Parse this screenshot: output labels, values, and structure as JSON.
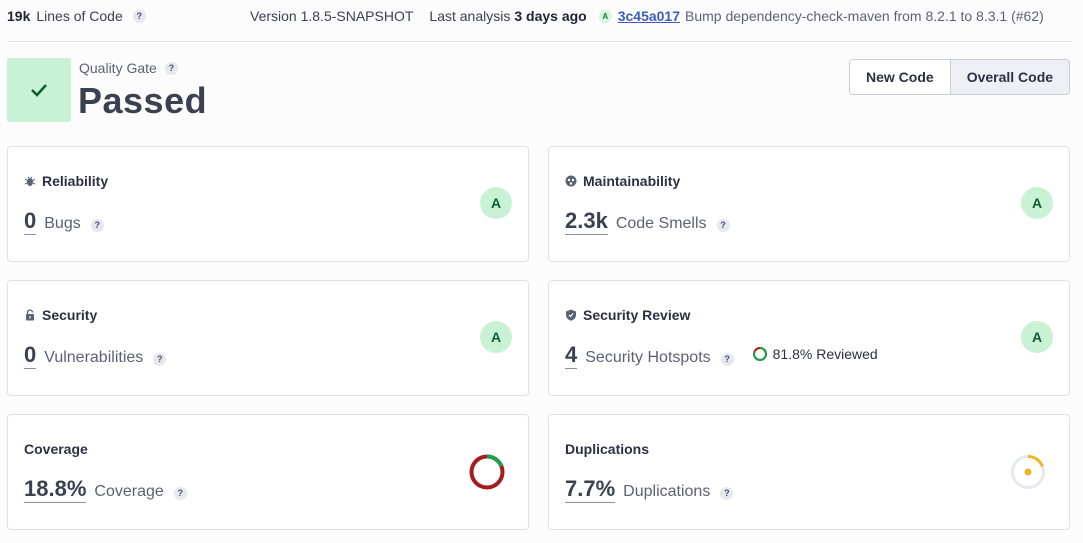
{
  "topbar": {
    "loc_value": "19k",
    "loc_label": "Lines of Code",
    "version": "Version 1.8.5-SNAPSHOT",
    "last_analysis_label": "Last analysis",
    "last_analysis_value": "3 days ago",
    "commit_grade": "A",
    "commit_hash": "3c45a017",
    "commit_message": "Bump dependency-check-maven from 8.2.1 to 8.3.1 (#62)"
  },
  "quality_gate": {
    "label": "Quality Gate",
    "status": "Passed",
    "color": "#c9f2d5"
  },
  "toggle": {
    "new_code": "New Code",
    "overall_code": "Overall Code",
    "selected": "Overall Code"
  },
  "cards": {
    "reliability": {
      "title": "Reliability",
      "value": "0",
      "label": "Bugs",
      "grade": "A",
      "icon": "bug-icon"
    },
    "maintainability": {
      "title": "Maintainability",
      "value": "2.3k",
      "label": "Code Smells",
      "grade": "A",
      "icon": "smell-icon"
    },
    "security": {
      "title": "Security",
      "value": "0",
      "label": "Vulnerabilities",
      "grade": "A",
      "icon": "lock-icon"
    },
    "security_review": {
      "title": "Security Review",
      "value": "4",
      "label": "Security Hotspots",
      "reviewed": "81.8% Reviewed",
      "reviewed_fraction": 0.818,
      "grade": "A",
      "icon": "shield-icon"
    },
    "coverage": {
      "title": "Coverage",
      "value": "18.8%",
      "label": "Coverage",
      "fraction": 0.188
    },
    "duplications": {
      "title": "Duplications",
      "value": "7.7%",
      "label": "Duplications",
      "fraction": 0.077
    }
  },
  "help_glyph": "?",
  "colors": {
    "grade_a_bg": "#c9f2d5",
    "link": "#3d5dbd",
    "coverage_good": "#1aa34a",
    "coverage_bad": "#a61d1d",
    "duplication": "#f0b429"
  }
}
